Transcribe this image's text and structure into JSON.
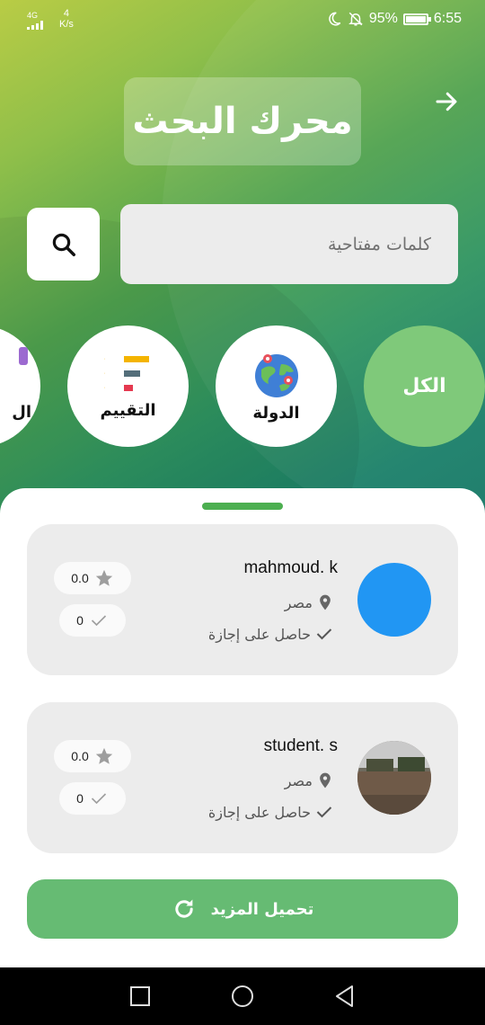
{
  "status_bar": {
    "network": "4G",
    "speed_value": "4",
    "speed_unit": "K/s",
    "battery": "95%",
    "time": "6:55"
  },
  "header": {
    "title": "محرك البحث"
  },
  "search": {
    "placeholder": "كلمات مفتاحية"
  },
  "filters": [
    {
      "label": "الكل",
      "selected": true
    },
    {
      "label": "الدولة",
      "icon": "globe-icon"
    },
    {
      "label": "التقييم",
      "icon": "rating-list-icon"
    },
    {
      "label": "ال",
      "icon": "partial-icon"
    }
  ],
  "results": [
    {
      "name": "mahmoud. k",
      "country": "مصر",
      "status": "حاصل على إجازة",
      "rating": "0.0",
      "count": "0",
      "avatar_color": "#2196f3"
    },
    {
      "name": "student. s",
      "country": "مصر",
      "status": "حاصل على إجازة",
      "rating": "0.0",
      "count": "0",
      "avatar_color": "#5a4a3a"
    }
  ],
  "load_more_label": "تحميل المزيد",
  "colors": {
    "accent": "#66bb73",
    "selected_filter": "#7fc97a",
    "handle": "#4caf50"
  }
}
